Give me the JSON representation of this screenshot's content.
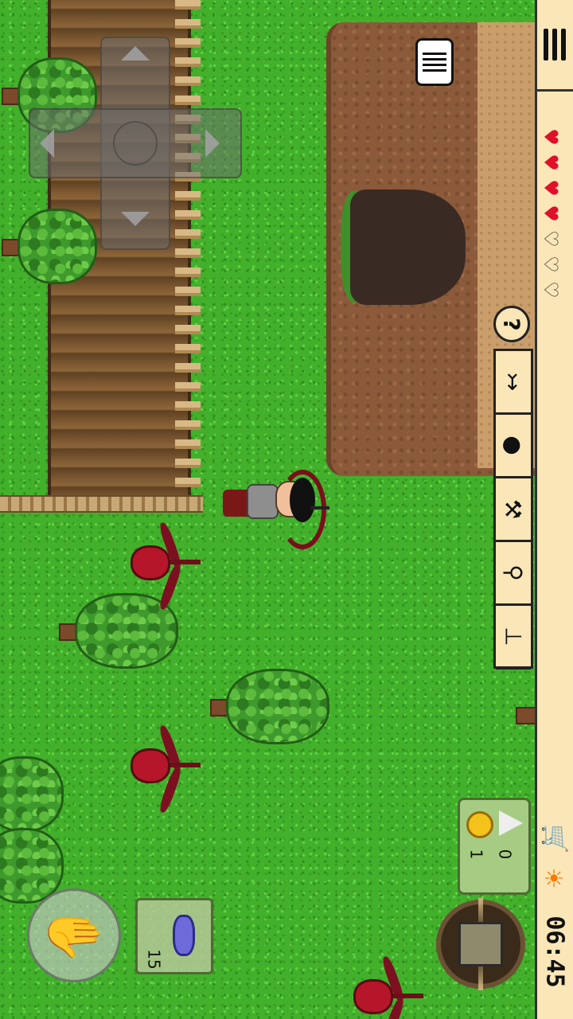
{
  "scene": {
    "background": "grassland",
    "colors": {
      "grass": "#43b02c",
      "cliff": "#8b5a3a",
      "hud": "#fbe6b8",
      "health": "#e0102a"
    }
  },
  "hud": {
    "menu_icon": "hamburger-menu-icon",
    "health": {
      "max_hearts": 7,
      "filled_hearts": 4,
      "full": "♥",
      "empty": "♡"
    },
    "help_label": "?",
    "tools": [
      {
        "name": "crossbow",
        "glyph": "↣"
      },
      {
        "name": "bomb",
        "glyph": "●"
      },
      {
        "name": "hammer",
        "glyph": "⚒"
      },
      {
        "name": "shovel",
        "glyph": "⚲"
      },
      {
        "name": "anvil",
        "glyph": "⊥"
      }
    ],
    "shop_icon": "shopping-cart-icon",
    "weather_icon": "sun-icon",
    "clock": "06:45"
  },
  "currency": {
    "coins": "1",
    "gems": "0"
  },
  "quick_slot": {
    "item": "blue-potion",
    "count": "15"
  },
  "controls": {
    "dpad": "direction-pad",
    "action": "hand-grab"
  }
}
